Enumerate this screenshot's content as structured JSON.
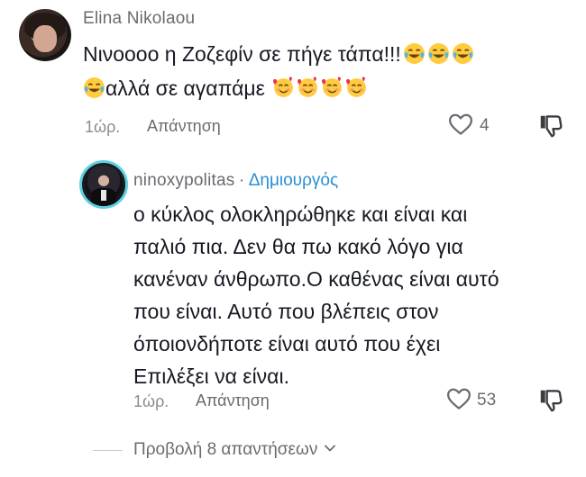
{
  "comments": [
    {
      "username": "Elina Nikolaou",
      "text_line1": "Νινοοοο η Ζοζεφίν σε πήγε τάπα!!!",
      "text_line2": "αλλά σε αγαπάμε",
      "time": "1ώρ.",
      "reply_label": "Απάντηση",
      "likes": "4"
    },
    {
      "username": "ninoxypolitas",
      "separator": "·",
      "creator_label": "Δημιουργός",
      "lines": [
        "ο κύκλος ολοκληρώθηκε και είναι και",
        "παλιό πια. Δεν θα πω κακό λόγο για",
        "κανέναν άνθρωπο.Ο καθένας είναι αυτό",
        "που είναι. Αυτό που βλέπεις στον",
        "όποιονδήποτε είναι αυτό που έχει",
        "Επιλέξει να είναι."
      ],
      "time": "1ώρ.",
      "reply_label": "Απάντηση",
      "likes": "53"
    }
  ],
  "view_replies": "Προβολή 8 απαντήσεων",
  "icons": {
    "like": "heart-outline-icon",
    "dislike": "thumbs-down-icon",
    "expand": "chevron-down-icon",
    "laugh": "tears-of-joy-emoji",
    "love": "smiling-face-with-hearts-emoji"
  },
  "colors": {
    "text": "#161823",
    "muted": "#6a6b72",
    "creator": "#2a8fd6",
    "avatar_ring": "#5ed2e0"
  }
}
